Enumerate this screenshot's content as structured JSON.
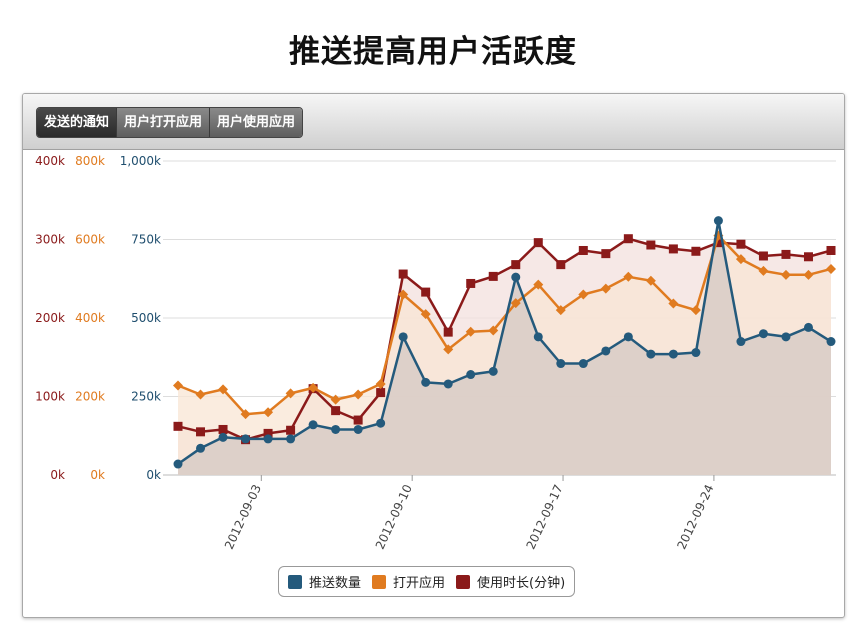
{
  "page": {
    "title": "推送提高用户活跃度"
  },
  "tabs": [
    {
      "label": "发送的通知",
      "active": true
    },
    {
      "label": "用户打开应用",
      "active": false
    },
    {
      "label": "用户使用应用",
      "active": false
    }
  ],
  "chart_data": {
    "type": "area",
    "x_tick_labels": [
      "2012-09-03",
      "2012-09-10",
      "2012-09-17",
      "2012-09-24"
    ],
    "x_tick_index": [
      3.7,
      10.4,
      17.1,
      23.8
    ],
    "grid": true,
    "legend_position": "bottom-center",
    "axes": [
      {
        "id": "duration",
        "color": "#8a1a1a",
        "ticks": [
          "0k",
          "100k",
          "200k",
          "300k",
          "400k"
        ],
        "max": 400000
      },
      {
        "id": "opens",
        "color": "#e07b20",
        "ticks": [
          "0k",
          "200k",
          "400k",
          "600k",
          "800k"
        ],
        "max": 800000
      },
      {
        "id": "pushes",
        "color": "#1f4e6e",
        "ticks": [
          "0k",
          "250k",
          "500k",
          "750k",
          "1,000k"
        ],
        "max": 1000000
      }
    ],
    "series": [
      {
        "name": "推送数量",
        "axis": "pushes",
        "color": "#245a7c",
        "fill": "#d8cbc6",
        "marker": "circle",
        "values": [
          35,
          85,
          120,
          115,
          115,
          115,
          160,
          145,
          145,
          165,
          440,
          295,
          290,
          320,
          330,
          630,
          440,
          355,
          355,
          395,
          440,
          385,
          385,
          390,
          810,
          425,
          450,
          440,
          470,
          425
        ]
      },
      {
        "name": "打开应用",
        "axis": "opens",
        "color": "#e07b20",
        "fill": "#f8e6d4",
        "marker": "diamond",
        "values": [
          228,
          205,
          218,
          155,
          160,
          208,
          222,
          192,
          205,
          232,
          460,
          410,
          320,
          365,
          368,
          438,
          485,
          420,
          460,
          475,
          505,
          495,
          437,
          420,
          610,
          550,
          520,
          510,
          510,
          525
        ]
      },
      {
        "name": "使用时长(分钟)",
        "axis": "duration",
        "color": "#8b1a1a",
        "fill": "#f3e0de",
        "marker": "square",
        "values": [
          62,
          55,
          58,
          45,
          53,
          57,
          110,
          82,
          70,
          105,
          256,
          233,
          182,
          244,
          253,
          268,
          296,
          268,
          286,
          282,
          301,
          293,
          288,
          285,
          296,
          294,
          279,
          281,
          278,
          286
        ]
      }
    ]
  }
}
